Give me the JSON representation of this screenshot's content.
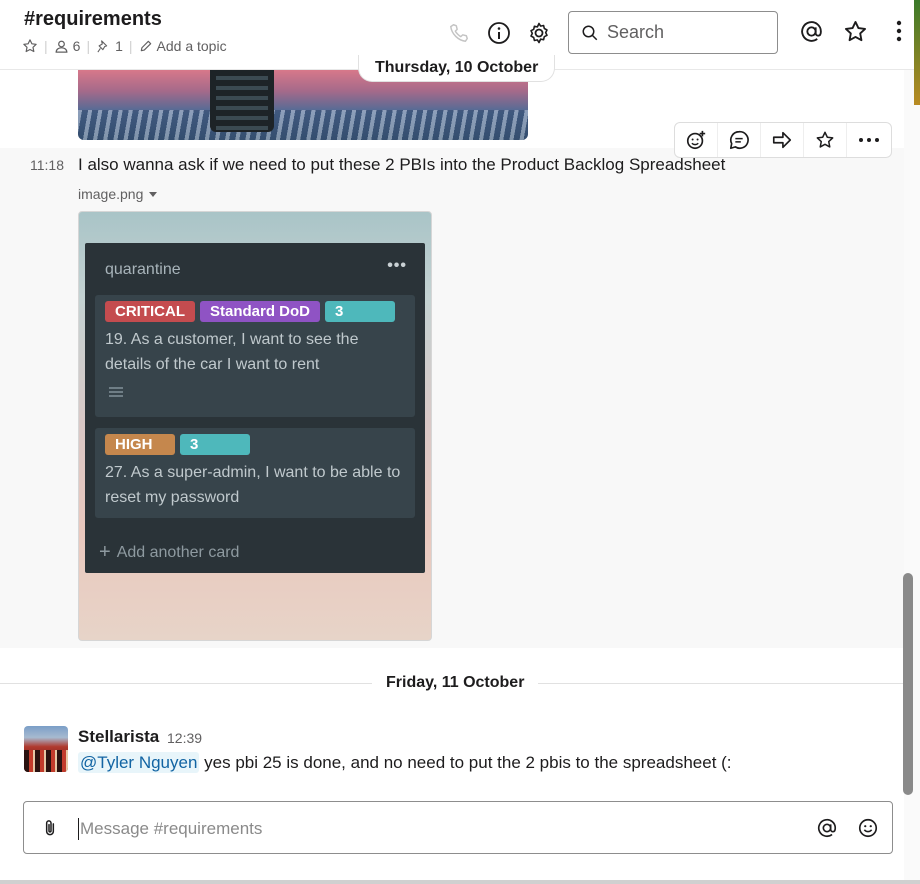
{
  "header": {
    "channel_name": "#requirements",
    "member_count": "6",
    "pinned_count": "1",
    "topic_placeholder": "Add a topic",
    "search_placeholder": "Search",
    "icons": [
      "star-icon",
      "person-icon",
      "pin-icon",
      "pencil-icon",
      "phone-icon",
      "info-icon",
      "gear-icon",
      "search-icon",
      "at-icon",
      "star-icon",
      "more-vertical-icon"
    ]
  },
  "date_dividers": {
    "first": "Thursday, 10 October",
    "second": "Friday, 11 October"
  },
  "message_actions": [
    "add-reaction-icon",
    "reply-thread-icon",
    "share-icon",
    "star-icon",
    "more-icon"
  ],
  "message1": {
    "time": "11:18",
    "text": "I also wanna ask if we need to put these 2 PBIs into the Product Backlog Spreadsheet",
    "file_name": "image.png"
  },
  "attachment": {
    "list_title": "quarantine",
    "more": "•••",
    "cards": [
      {
        "labels": [
          "CRITICAL",
          "Standard DoD",
          "3"
        ],
        "text": "19. As a customer, I want to see the details of the car I want to rent"
      },
      {
        "labels": [
          "HIGH",
          "3"
        ],
        "text": "27. As a super-admin, I want to be able to reset my password"
      }
    ],
    "add_card": "Add another card",
    "colors": {
      "critical": "#c44c4f",
      "dod": "#8f53c4",
      "count": "#4eb8bb",
      "high": "#c5874d"
    }
  },
  "message2": {
    "author": "Stellarista",
    "time": "12:39",
    "mention": "@Tyler Nguyen",
    "text": " yes pbi 25 is done, and no need to put the 2 pbis to the spreadsheet (:"
  },
  "composer": {
    "placeholder": "Message #requirements"
  },
  "colors": {
    "link": "#1264a3",
    "mention_bg": "#e8f5fa"
  }
}
